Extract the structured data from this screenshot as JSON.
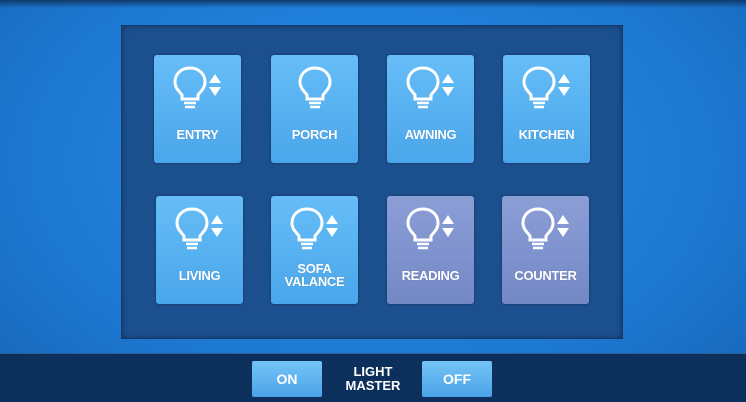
{
  "lights": [
    {
      "label": "ENTRY",
      "icon": "bulb-dimmer-icon"
    },
    {
      "label": "PORCH",
      "icon": "bulb-icon"
    },
    {
      "label": "AWNING",
      "icon": "bulb-dimmer-icon"
    },
    {
      "label": "KITCHEN",
      "icon": "bulb-dimmer-icon"
    },
    {
      "label": "LIVING",
      "icon": "bulb-dimmer-icon"
    },
    {
      "label": "SOFA\nVALANCE",
      "icon": "bulb-dimmer-icon"
    },
    {
      "label": "READING",
      "icon": "bulb-dimmer-icon"
    },
    {
      "label": "COUNTER",
      "icon": "bulb-dimmer-icon"
    }
  ],
  "master": {
    "on_label": "ON",
    "title_line1": "LIGHT",
    "title_line2": "MASTER",
    "off_label": "OFF"
  },
  "colors": {
    "background": "#1f7fd8",
    "panel": "#1c4f8e",
    "tile_active": "#5ab3f1",
    "tile_inactive": "#7f93ce",
    "bottom_bar": "#0d2f5c"
  }
}
